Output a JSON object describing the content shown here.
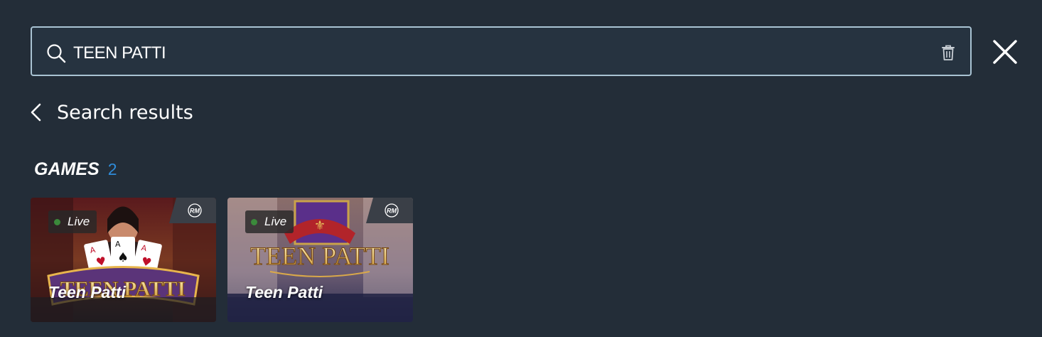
{
  "search": {
    "value": "TEEN PATTI",
    "icon": "search-icon",
    "clear_icon": "trash-icon"
  },
  "close_icon": "close-icon",
  "results": {
    "back_icon": "chevron-left-icon",
    "title": "Search results"
  },
  "games_section": {
    "title": "GAMES",
    "count": "2",
    "count_color": "#2f8bd8"
  },
  "games": [
    {
      "title": "Teen Patti",
      "status": "Live",
      "badge": "RM",
      "art_text": "TEEN PATTI"
    },
    {
      "title": "Teen Patti",
      "status": "Live",
      "badge": "RM",
      "art_text": "TEEN PATTI"
    }
  ],
  "colors": {
    "background": "#232d38",
    "search_border": "#a9c3d3",
    "live_dot": "#3b8a3b"
  }
}
